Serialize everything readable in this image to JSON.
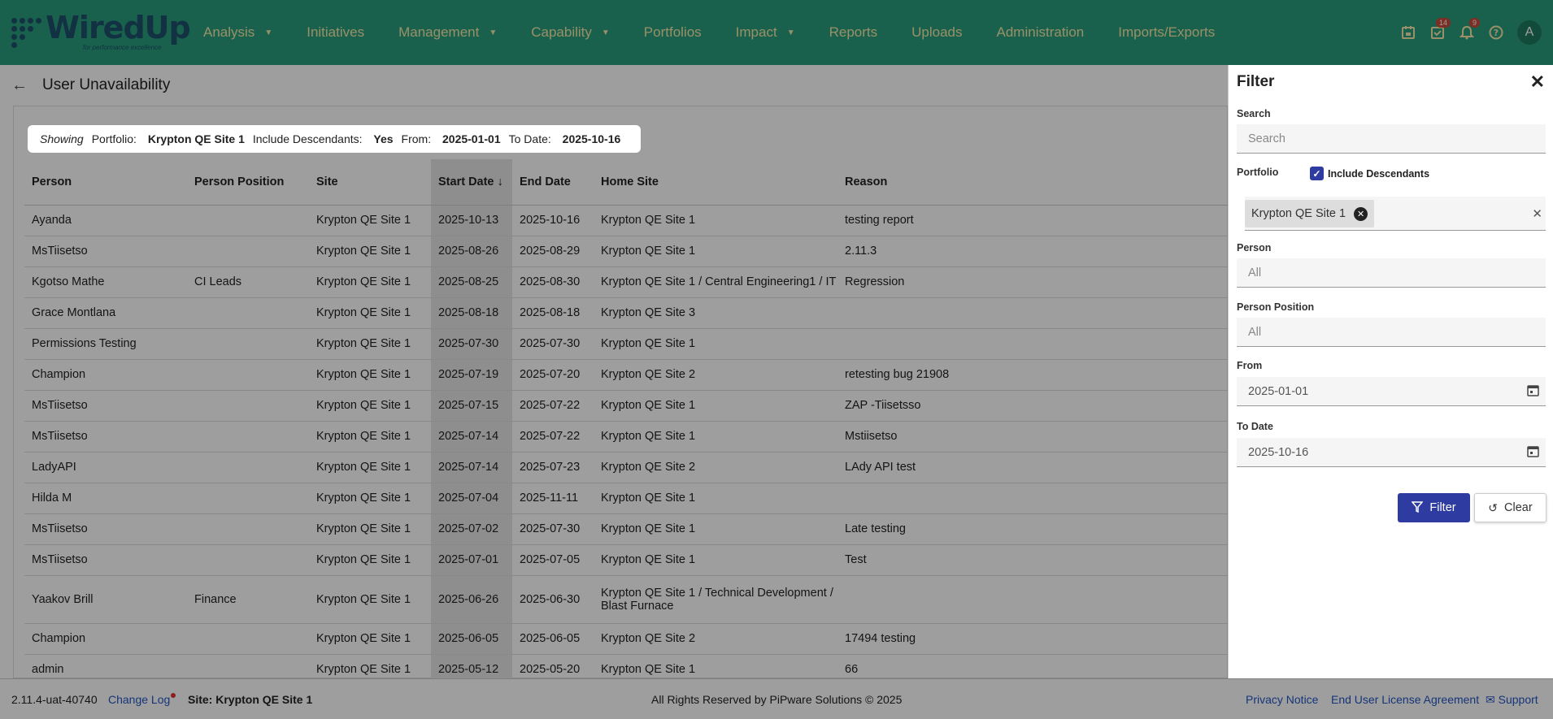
{
  "brand": {
    "name": "WiredUp",
    "tagline": "for performance excellence"
  },
  "nav": {
    "items": [
      {
        "label": "Analysis",
        "has_dropdown": true
      },
      {
        "label": "Initiatives",
        "has_dropdown": false
      },
      {
        "label": "Management",
        "has_dropdown": true
      },
      {
        "label": "Capability",
        "has_dropdown": true
      },
      {
        "label": "Portfolios",
        "has_dropdown": false
      },
      {
        "label": "Impact",
        "has_dropdown": true
      },
      {
        "label": "Reports",
        "has_dropdown": false
      },
      {
        "label": "Uploads",
        "has_dropdown": false
      },
      {
        "label": "Administration",
        "has_dropdown": false
      },
      {
        "label": "Imports/Exports",
        "has_dropdown": false
      }
    ],
    "icons": {
      "calendar": "calendar-icon",
      "tasks": "task-check-icon",
      "tasks_badge": "14",
      "bell": "bell-icon",
      "bell_badge": "9",
      "help": "help-icon"
    },
    "avatar_initial": "A"
  },
  "page": {
    "title": "User Unavailability"
  },
  "showing": {
    "lead": "Showing",
    "portfolio_label": "Portfolio:",
    "portfolio_value": "Krypton QE Site 1",
    "descendants_label": "Include Descendants:",
    "descendants_value": "Yes",
    "from_label": "From:",
    "from_value": "2025-01-01",
    "to_label": "To Date:",
    "to_value": "2025-10-16"
  },
  "table": {
    "headers": [
      "Person",
      "Person Position",
      "Site",
      "Start Date",
      "End Date",
      "Home Site",
      "Reason"
    ],
    "sort_indicator": "↓",
    "rows": [
      [
        "Ayanda",
        "",
        "Krypton QE Site 1",
        "2025-10-13",
        "2025-10-16",
        "Krypton QE Site 1",
        "testing report"
      ],
      [
        "MsTiisetso",
        "",
        "Krypton QE Site 1",
        "2025-08-26",
        "2025-08-29",
        "Krypton QE Site 1",
        "2.11.3"
      ],
      [
        "Kgotso Mathe",
        "CI Leads",
        "Krypton QE Site 1",
        "2025-08-25",
        "2025-08-30",
        "Krypton QE Site 1 / Central Engineering1 / IT",
        "Regression"
      ],
      [
        "Grace Montlana",
        "",
        "Krypton QE Site 1",
        "2025-08-18",
        "2025-08-18",
        "Krypton QE Site 3",
        ""
      ],
      [
        "Permissions Testing",
        "",
        "Krypton QE Site 1",
        "2025-07-30",
        "2025-07-30",
        "Krypton QE Site 1",
        ""
      ],
      [
        "Champion",
        "",
        "Krypton QE Site 1",
        "2025-07-19",
        "2025-07-20",
        "Krypton QE Site 2",
        "retesting bug 21908"
      ],
      [
        "MsTiisetso",
        "",
        "Krypton QE Site 1",
        "2025-07-15",
        "2025-07-22",
        "Krypton QE Site 1",
        "ZAP -Tiisetsso"
      ],
      [
        "MsTiisetso",
        "",
        "Krypton QE Site 1",
        "2025-07-14",
        "2025-07-22",
        "Krypton QE Site 1",
        "Mstiisetso"
      ],
      [
        "LadyAPI",
        "",
        "Krypton QE Site 1",
        "2025-07-14",
        "2025-07-23",
        "Krypton QE Site 2",
        "LAdy API test"
      ],
      [
        "Hilda M",
        "",
        "Krypton QE Site 1",
        "2025-07-04",
        "2025-11-11",
        "Krypton QE Site 1",
        ""
      ],
      [
        "MsTiisetso",
        "",
        "Krypton QE Site 1",
        "2025-07-02",
        "2025-07-30",
        "Krypton QE Site 1",
        "Late testing"
      ],
      [
        "MsTiisetso",
        "",
        "Krypton QE Site 1",
        "2025-07-01",
        "2025-07-05",
        "Krypton QE Site 1",
        "Test"
      ],
      [
        "Yaakov Brill",
        "Finance",
        "Krypton QE Site 1",
        "2025-06-26",
        "2025-06-30",
        "Krypton QE Site 1 / Technical Development / Blast Furnace",
        ""
      ],
      [
        "Champion",
        "",
        "Krypton QE Site 1",
        "2025-06-05",
        "2025-06-05",
        "Krypton QE Site 2",
        "17494 testing"
      ],
      [
        "admin",
        "",
        "Krypton QE Site 1",
        "2025-05-12",
        "2025-05-20",
        "Krypton QE Site 1",
        "66"
      ]
    ]
  },
  "filter": {
    "title": "Filter",
    "search_label": "Search",
    "search_placeholder": "Search",
    "portfolio_label": "Portfolio",
    "include_descendants_label": "Include Descendants",
    "include_descendants_checked": true,
    "portfolio_chip": "Krypton QE Site 1",
    "person_label": "Person",
    "person_placeholder": "All",
    "position_label": "Person Position",
    "position_placeholder": "All",
    "from_label": "From",
    "from_value": "2025-01-01",
    "to_label": "To Date",
    "to_value": "2025-10-16",
    "filter_button": "Filter",
    "clear_button": "Clear"
  },
  "footer": {
    "version": "2.11.4-uat-40740",
    "changelog": "Change Log",
    "site": "Site: Krypton QE Site 1",
    "rights": "All Rights Reserved by PiPware Solutions © 2025",
    "privacy": "Privacy Notice",
    "eula": "End User License Agreement",
    "support": "Support"
  },
  "colors": {
    "topbar": "#2a9d7c",
    "nav_text": "#f5e8a8",
    "primary_button": "#2e3ba0",
    "link": "#2256c4"
  }
}
